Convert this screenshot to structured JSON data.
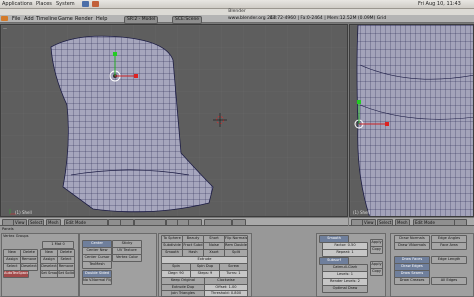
{
  "gnome_panel": {
    "menus": [
      "Applications",
      "Places",
      "System"
    ],
    "clock": "Fri Aug 10, 11:43"
  },
  "window": {
    "title": "Blender"
  },
  "info_header": {
    "menus": [
      "File",
      "Add",
      "Timeline",
      "Game",
      "Render",
      "Help"
    ],
    "screen": "SR:2 - Model",
    "scene": "SCE:Scene",
    "url": "www.blender.org 247",
    "stats": "Ed:72-4960 | Fa:0-2464 | Mem:12.52M (0.09M) Grid"
  },
  "viewport_left": {
    "label": "(1) Shell",
    "header": {
      "view_label": "View",
      "select_label": "Select",
      "mesh_label": "Mesh",
      "mode": "Edit Mode"
    }
  },
  "viewport_right": {
    "label": "(1) Shell",
    "header": {
      "view_label": "View",
      "select_label": "Select",
      "mesh_label": "Mesh",
      "mode": "Edit Mode"
    }
  },
  "buttons": {
    "panels_label": "Panels",
    "link_materials": "Link and Materials",
    "vertex_groups": "Vertex Groups",
    "mat_field": "1 Mat 0",
    "row1": [
      "New",
      "Delete",
      "Assign",
      "Remove",
      "Select",
      "Deselect"
    ],
    "set_smooth": "Set Smooth",
    "set_solid": "Set Solid",
    "autotex_space": "AutoTexSpace",
    "mesh_panel": {
      "title": "Mesh",
      "buttons": [
        "Sticky",
        "UV Texture",
        "Vertex Color",
        "TexMesh",
        "Center",
        "Center New",
        "Center Cursor",
        "Double Sided",
        "No V.Normal Flip"
      ]
    },
    "mesh_tools": {
      "title": "Mesh Tools",
      "buttons": [
        "Beauty",
        "Short",
        "Subdivide",
        "Fract Subd",
        "Noise",
        "Hash",
        "Xsort",
        "To Sphere",
        "Smooth",
        "Split",
        "Flip Normals",
        "Rem Doubles",
        "Extrude",
        "Spin",
        "Spin Dup",
        "Screw",
        "Degr: 90",
        "Steps: 9",
        "Turns: 1",
        "Keep Original",
        "Clockwise",
        "Extrude Dup",
        "Offset: 1.00",
        "Join Triangles",
        "Threshold: 0.800",
        "Delimit UVs",
        "Delimit Vcol",
        "Delimit Sharp",
        "Delimit Mat"
      ]
    },
    "modifiers": {
      "smooth_label": "Smooth",
      "decimator_label": "Decimator",
      "subsurf_label": "Subsurf",
      "factor": "Factor: 0.50",
      "repeat": "Repeat: 1",
      "catmull": "Catmull-Clark",
      "levels": "Levels: 1",
      "render_levels": "Render Levels: 2",
      "optimal_draw": "Optimal Draw"
    },
    "mesh_tools_more": {
      "title": "Mesh Tools More",
      "buttons": [
        "Draw Faces",
        "Draw Edges",
        "Draw Seams",
        "Draw Creases",
        "Draw Normals",
        "Draw VNormals",
        "Edge Angles",
        "Face Area",
        "Edge Length",
        "All Edges"
      ]
    },
    "side_labels": [
      "Apply",
      "Copy",
      "Ctrl",
      "Apply",
      "Copy"
    ]
  }
}
